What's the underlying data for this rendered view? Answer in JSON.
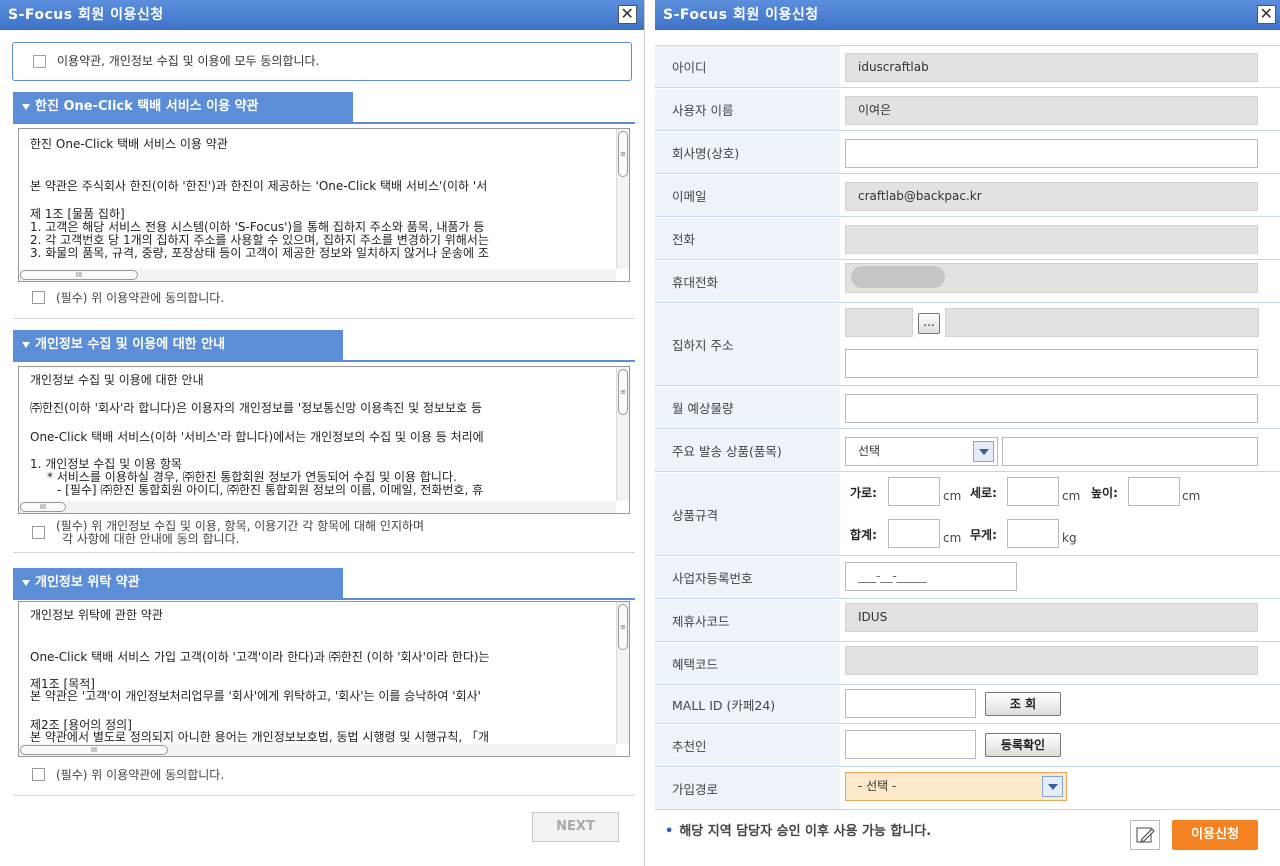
{
  "left_window": {
    "title": "S-Focus 회원 이용신청",
    "close_glyph": "✕",
    "agree_all": "이용약관, 개인정보 수집 및 이용에 모두 동의합니다.",
    "sections": [
      {
        "heading": "한진 One-Click 택배 서비스 이용 약관",
        "lines": [
          "한진 One-Click 택배 서비스 이용 약관",
          "본 약관은 주식회사 한진(이하 '한진')과 한진이 제공하는 'One-Click 택배 서비스'(이하 '서",
          "제 1조 [물품 집하]",
          "1. 고객은 해당 서비스 전용 시스템(이하 'S-Focus')을 통해 집하지 주소와 품목, 내품가 등",
          "2. 각 고객번호 당 1개의 집하지 주소를 사용할 수 있으며, 집하지 주소를 변경하기 위해서는",
          "3. 화물의 품목, 규격, 중량, 포장상태 등이 고객이 제공한 정보와 일치하지 않거나 운송에 조"
        ],
        "consent": "(필수) 위 이용약관에 동의합니다."
      },
      {
        "heading": "개인정보 수집 및 이용에 대한 안내",
        "lines": [
          "개인정보 수집 및 이용에 대한 안내",
          "㈜한진(이하 '회사'라 합니다)은 이용자의 개인정보를 '정보통신망 이용촉진 및 정보보호 등",
          "One-Click 택배 서비스(이하 '서비스'라 합니다)에서는 개인정보의 수집 및 이용 등 처리에",
          "1. 개인정보 수집 및 이용 항목",
          "* 서비스를 이용하실 경우, ㈜한진 통합회원 정보가 연동되어 수집 및 이용 합니다.",
          "- [필수] ㈜한진 통합회원 아이디, ㈜한진 통합회원 정보의 이름, 이메일, 전화번호, 휴"
        ],
        "consent_line1": "(필수) 위 개인정보 수집 및 이용, 항목, 이용기간 각 항목에 대해 인지하며",
        "consent_line2": "각 사항에 대한 안내에 동의 합니다."
      },
      {
        "heading": "개인정보 위탁 약관",
        "lines": [
          "개인정보 위탁에 관한 약관",
          "One-Click 택배 서비스 가입 고객(이하 '고객'이라 한다)과 ㈜한진 (이하 '회사'이라 한다)는",
          "제1조 [목적]",
          "본 약관은 '고객'이 개인정보처리업무를 '회사'에게 위탁하고, '회사'는 이를 승낙하여 '회사'",
          "제2조 [용어의 정의]",
          "본 약관에서 별도로 정의되지 아니한 용어는 개인정보보호법, 동법 시행령 및 시행규칙, 「개"
        ],
        "consent": "(필수) 위 이용약관에 동의합니다."
      }
    ],
    "scroll_grip": "III",
    "next_label": "NEXT"
  },
  "right_window": {
    "title": "S-Focus 회원 이용신청",
    "close_glyph": "✕",
    "fields": {
      "user_id": {
        "label": "아이디",
        "value": "iduscraftlab"
      },
      "user_name": {
        "label": "사용자 이름",
        "value": "이여은"
      },
      "company": {
        "label": "회사명(상호)",
        "value": ""
      },
      "email": {
        "label": "이메일",
        "value": "craftlab@backpac.kr"
      },
      "phone": {
        "label": "전화",
        "value": ""
      },
      "mobile": {
        "label": "휴대전화",
        "value": ""
      },
      "pickup_address": {
        "label": "집하지 주소",
        "search_glyph": "..."
      },
      "monthly_volume": {
        "label": "월 예상물량",
        "value": ""
      },
      "main_product": {
        "label": "주요 발송 상품(품목)",
        "selected": "선택"
      },
      "product_spec": {
        "label": "상품규격",
        "width_label": "가로:",
        "depth_label": "세로:",
        "height_label": "높이:",
        "sum_label": "합계:",
        "weight_label": "무게:",
        "unit_cm": "cm",
        "unit_kg": "kg"
      },
      "biz_reg_no": {
        "label": "사업자등록번호",
        "value": "___-__-_____"
      },
      "partner_code": {
        "label": "제휴사코드",
        "value": "IDUS"
      },
      "benefit_code": {
        "label": "혜택코드",
        "value": ""
      },
      "mall_id": {
        "label": "MALL ID (카페24)",
        "button": "조 회"
      },
      "referrer": {
        "label": "추천인",
        "button": "등록확인"
      },
      "join_path": {
        "label": "가입경로",
        "selected": "- 선택 -"
      }
    },
    "footnote": "해당 지역 담당자 승인 이후 사용 가능 합니다.",
    "footnote_bullet": "•",
    "apply_label": "이용신청"
  },
  "colors": {
    "titlebar": "#3d72c8",
    "section_header": "#5b8ed6",
    "label_bg": "#eef3fa",
    "readonly_bg": "#e2e2e2",
    "apply_button": "#f58220",
    "join_path_bg": "#fde8cc"
  }
}
